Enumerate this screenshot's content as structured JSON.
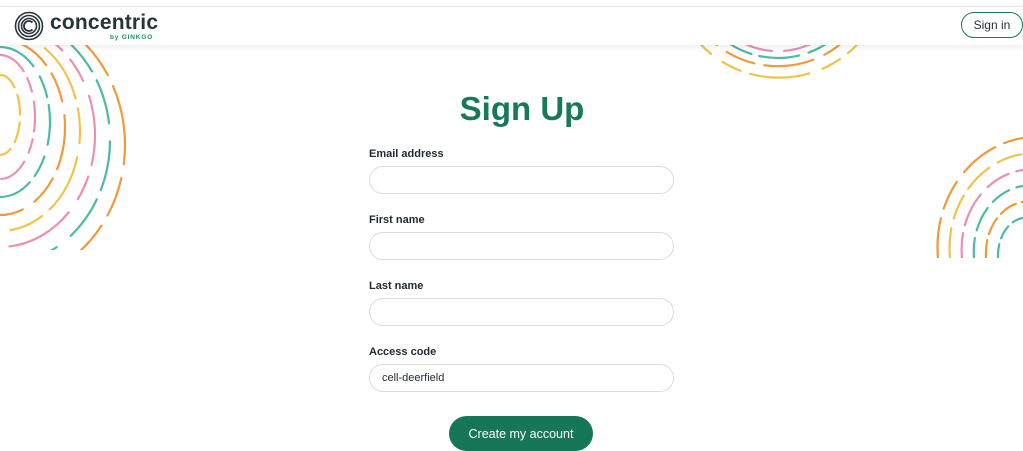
{
  "header": {
    "brand": "concentric",
    "brand_sub": "by GINKGO",
    "signin_label": "Sign in"
  },
  "form": {
    "title": "Sign Up",
    "fields": [
      {
        "label": "Email address",
        "value": ""
      },
      {
        "label": "First name",
        "value": ""
      },
      {
        "label": "Last name",
        "value": ""
      },
      {
        "label": "Access code",
        "value": "cell-deerfield"
      }
    ],
    "submit_label": "Create my account"
  },
  "colors": {
    "accent": "#15765a",
    "deco_orange": "#ef9a3c",
    "deco_pink": "#ea8fb6",
    "deco_teal": "#4fb9a7",
    "deco_yellow": "#f1c24c"
  }
}
